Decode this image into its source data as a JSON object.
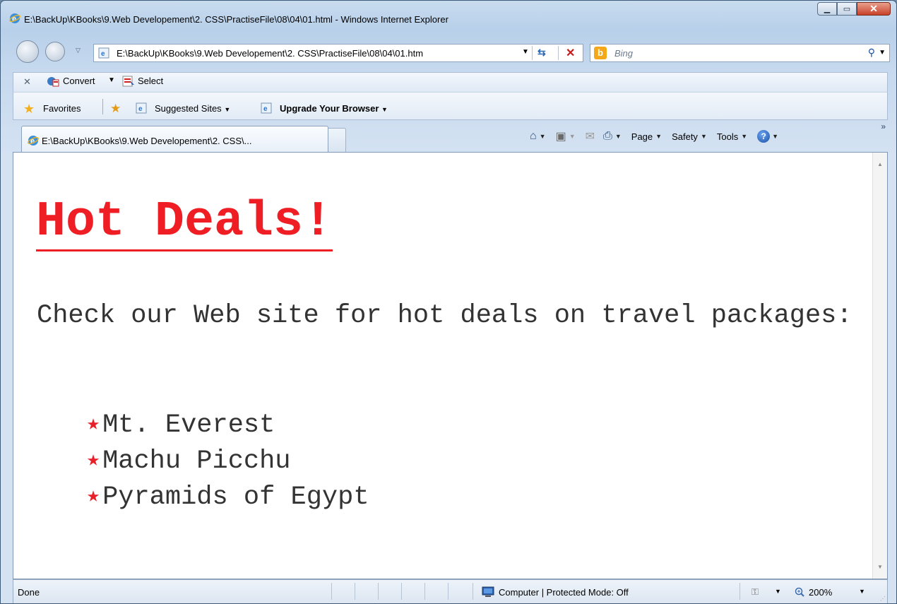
{
  "window": {
    "title": "E:\\BackUp\\KBooks\\9.Web Developement\\2. CSS\\PractiseFile\\08\\04\\01.html - Windows Internet Explorer",
    "minimize_icon": "minimize-icon",
    "maximize_icon": "maximize-icon",
    "close_icon": "close-icon"
  },
  "navigation": {
    "address": "E:\\BackUp\\KBooks\\9.Web Developement\\2. CSS\\PractiseFile\\08\\04\\01.htm",
    "search_placeholder": "Bing",
    "search_logo": "b"
  },
  "command_bar": {
    "convert_label": "Convert",
    "select_label": "Select"
  },
  "favorites_bar": {
    "favorites_label": "Favorites",
    "suggested_sites_label": "Suggested Sites",
    "upgrade_label": "Upgrade Your Browser"
  },
  "tabs": [
    {
      "label": "E:\\BackUp\\KBooks\\9.Web Developement\\2. CSS\\..."
    }
  ],
  "toolbar": {
    "page_label": "Page",
    "safety_label": "Safety",
    "tools_label": "Tools",
    "help_glyph": "?"
  },
  "page": {
    "heading": "Hot Deals!",
    "intro": "Check our Web site for hot deals on travel packages:",
    "deals": [
      "Mt. Everest",
      "Machu Picchu",
      "Pyramids of Egypt"
    ],
    "accent_color": "#ee1e24"
  },
  "status_bar": {
    "status": "Done",
    "zone": "Computer | Protected Mode: Off",
    "zoom": "200%"
  }
}
